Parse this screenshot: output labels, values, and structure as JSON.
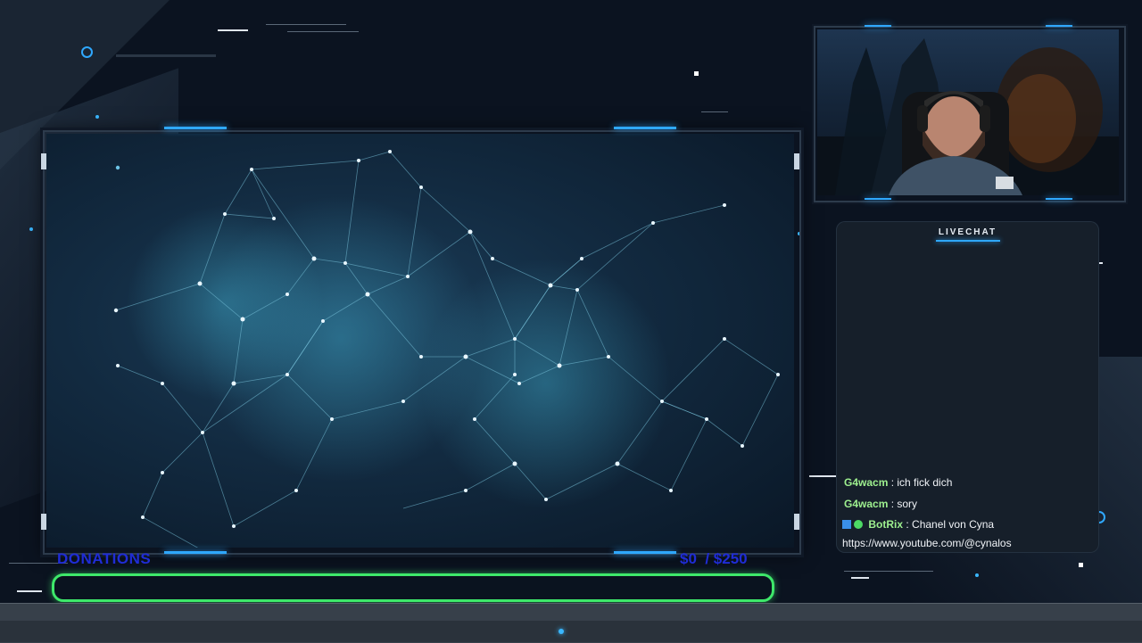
{
  "chat": {
    "title": "LIVECHAT",
    "messages": [
      {
        "user": "G4wacm",
        "sep": " : ",
        "text": "ich fick dich"
      },
      {
        "user": "G4wacm",
        "sep": " : ",
        "text": "sory"
      },
      {
        "user": "BotRix",
        "sep": " : ",
        "text": "Chanel von Cyna"
      },
      {
        "text": "https://www.youtube.com/@cynalos"
      }
    ]
  },
  "donations": {
    "label": "DONATIONS",
    "amount": "$0  / $250",
    "progress_fraction": 0
  },
  "colors": {
    "accent": "#2fa8ff",
    "donation_bar": "#3ee86a",
    "donation_text": "#1f2cd6",
    "chat_user": "#9ef08f"
  },
  "icons": {
    "bot_badge": "bot-badge-icon",
    "verified_badge": "verified-badge-icon"
  }
}
